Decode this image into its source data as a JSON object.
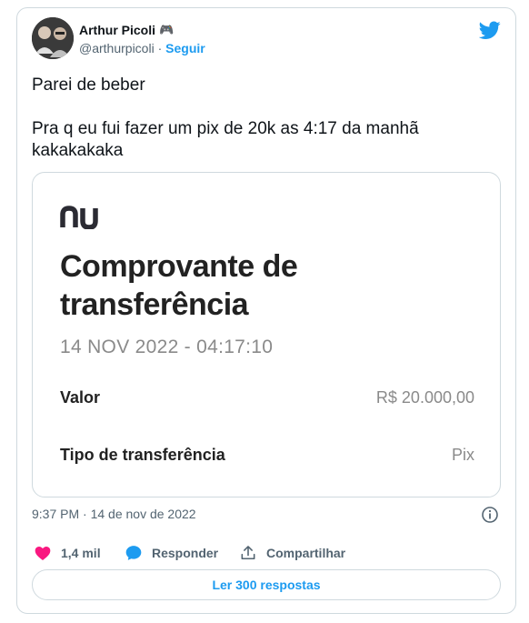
{
  "author": {
    "name": "Arthur Picoli",
    "name_emoji": "🎮",
    "handle": "@arthurpicoli",
    "separator": " · ",
    "follow_label": "Seguir"
  },
  "tweet": {
    "line1": "Parei de beber",
    "line2": "Pra q eu fui fazer um pix de 20k as 4:17 da manhã kakakakaka"
  },
  "receipt": {
    "brand": "nu",
    "title_line1": "Comprovante de",
    "title_line2": "transferência",
    "datetime": "14 NOV 2022 - 04:17:10",
    "rows": [
      {
        "label": "Valor",
        "value": "R$ 20.000,00"
      },
      {
        "label": "Tipo de transferência",
        "value": "Pix"
      }
    ]
  },
  "meta": {
    "timestamp": "9:37 PM · 14 de nov de 2022"
  },
  "actions": {
    "likes": "1,4 mil",
    "reply_label": "Responder",
    "share_label": "Compartilhar"
  },
  "replies_button": "Ler 300 respostas",
  "colors": {
    "twitter_blue": "#1d9bf0",
    "like_red": "#f91880",
    "text_dark": "#0f1419",
    "text_muted": "#536471"
  },
  "icons": [
    "avatar",
    "twitter-bird-icon",
    "nubank-logo",
    "info-icon",
    "heart-icon",
    "reply-bubble-icon",
    "share-icon"
  ]
}
